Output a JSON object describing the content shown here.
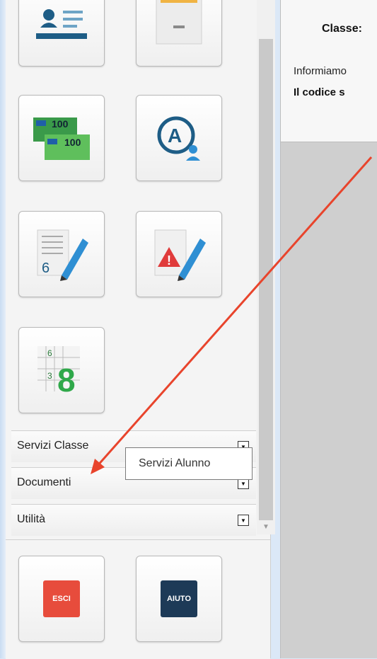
{
  "sidebar": {
    "tiles": [
      {
        "name": "student-card-icon"
      },
      {
        "name": "drawer-icon"
      },
      {
        "name": "money-icon",
        "amounts": [
          "100",
          "100"
        ]
      },
      {
        "name": "user-a-icon",
        "letter": "A"
      },
      {
        "name": "grades-edit-icon",
        "number": "6"
      },
      {
        "name": "notes-warning-icon",
        "mark": "!"
      },
      {
        "name": "grid-grades-icon",
        "small": [
          "6",
          "3"
        ],
        "big": "8"
      }
    ],
    "sections": [
      {
        "label": "Servizi Classe"
      },
      {
        "label": "Documenti"
      },
      {
        "label": "Utilità"
      }
    ],
    "tooltip": "Servizi Alunno"
  },
  "bottom": {
    "exit_label": "ESCI",
    "help_label": "AIUTO"
  },
  "main": {
    "title": "Classe:",
    "info": "Informiamo",
    "code": "Il codice s"
  },
  "colors": {
    "accent_red": "#e74c3c",
    "dark_blue": "#1d3a57",
    "arrow": "#e8442c"
  }
}
